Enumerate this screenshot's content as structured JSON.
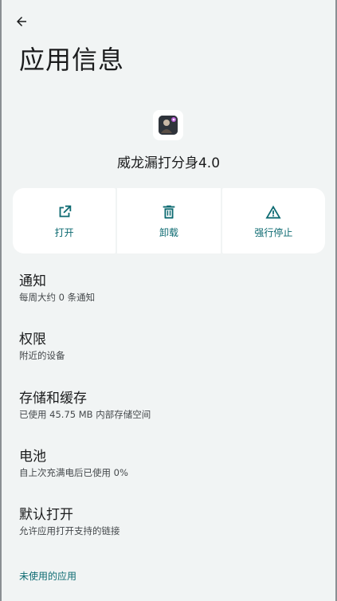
{
  "header": {
    "back_icon": "arrow-left-icon",
    "title": "应用信息"
  },
  "app": {
    "icon": "app-icon",
    "name": "威龙漏打分身4.0"
  },
  "actions": [
    {
      "icon": "open-external-icon",
      "label": "打开"
    },
    {
      "icon": "trash-icon",
      "label": "卸载"
    },
    {
      "icon": "warning-triangle-icon",
      "label": "强行停止"
    }
  ],
  "prefs": [
    {
      "title": "通知",
      "summary": "每周大约 0 条通知"
    },
    {
      "title": "权限",
      "summary": "附近的设备"
    },
    {
      "title": "存储和缓存",
      "summary": "已使用 45.75 MB 内部存储空间"
    },
    {
      "title": "电池",
      "summary": "自上次充满电后已使用 0%"
    },
    {
      "title": "默认打开",
      "summary": "允许应用打开支持的链接"
    }
  ],
  "unused_apps_link": "未使用的应用",
  "colors": {
    "background": "#f1f4f4",
    "accent": "#0e6b72",
    "card": "#ffffff"
  }
}
